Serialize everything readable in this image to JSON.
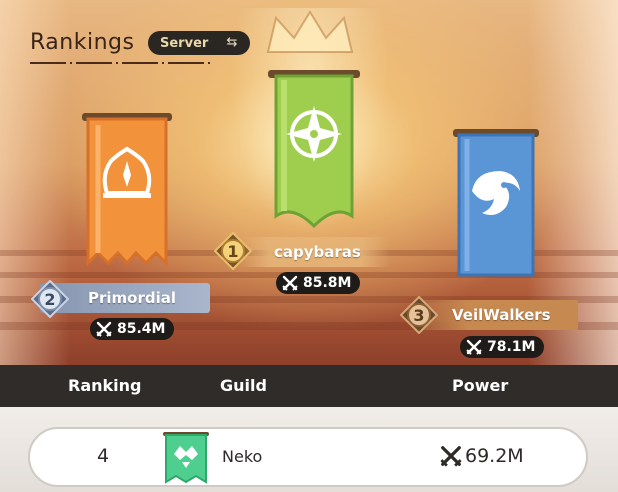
{
  "header": {
    "title": "Rankings",
    "scope_label": "Server",
    "swap_icon": "swap-icon"
  },
  "podium": [
    {
      "rank": "1",
      "guild": "capybaras",
      "power": "85.8M",
      "banner_color": "#9fce4e",
      "emblem": "compass-star-emblem"
    },
    {
      "rank": "2",
      "guild": "Primordial",
      "power": "85.4M",
      "banner_color": "#f2923a",
      "emblem": "crown-spire-emblem"
    },
    {
      "rank": "3",
      "guild": "VeilWalkers",
      "power": "78.1M",
      "banner_color": "#5a95d6",
      "emblem": "wave-spirit-emblem"
    }
  ],
  "table": {
    "columns": [
      "Ranking",
      "Guild",
      "Power"
    ]
  },
  "my_guild": {
    "rank": "4",
    "guild": "Neko",
    "power": "69.2M",
    "banner_color": "#4fcf8f"
  },
  "colors": {
    "header_bar": "#302c2a",
    "chip_bg": "#1f1b19"
  }
}
